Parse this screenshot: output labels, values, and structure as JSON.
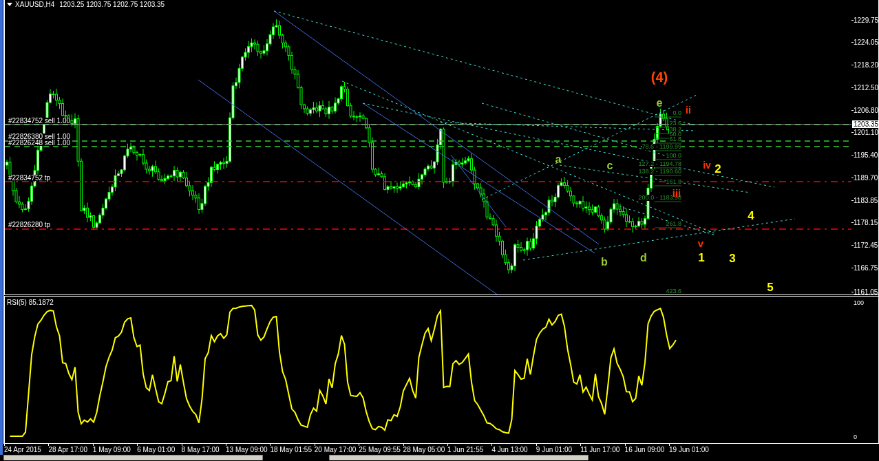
{
  "header": {
    "symbol": "XAUUSD,H4",
    "ohlc": "1203.25 1203.75 1202.75 1203.35"
  },
  "price_axis": {
    "ticks": [
      "1229.75",
      "1224.05",
      "1218.20",
      "1212.50",
      "1206.80",
      "1201.10",
      "1195.40",
      "1189.70",
      "1183.85",
      "1178.15",
      "1172.45",
      "1166.75",
      "1161.05"
    ],
    "current_price": "1203.35"
  },
  "orders": [
    {
      "label": "#22834752 sell 1.00",
      "kind": "sell"
    },
    {
      "label": "#22826380 sell 1.00",
      "kind": "sell"
    },
    {
      "label": "#22826248 sell 1.00",
      "kind": "sell"
    },
    {
      "label": "#22834752 tp",
      "kind": "tp"
    },
    {
      "label": "#22826280 tp",
      "kind": "tp"
    }
  ],
  "wave_labels": [
    {
      "text": "(4)",
      "color": "#ff4500"
    },
    {
      "text": "e",
      "color": "#9acd32"
    },
    {
      "text": "a",
      "color": "#9acd32"
    },
    {
      "text": "c",
      "color": "#9acd32"
    },
    {
      "text": "b",
      "color": "#9acd32"
    },
    {
      "text": "d",
      "color": "#9acd32"
    },
    {
      "text": "ii",
      "color": "#ff3300"
    },
    {
      "text": "iv",
      "color": "#ff3300"
    },
    {
      "text": "iii",
      "color": "#ff3300"
    },
    {
      "text": "v",
      "color": "#ff3300"
    },
    {
      "text": "2",
      "color": "#ffff00"
    },
    {
      "text": "4",
      "color": "#ffff00"
    },
    {
      "text": "1",
      "color": "#ffff00"
    },
    {
      "text": "3",
      "color": "#ffff00"
    },
    {
      "text": "5",
      "color": "#ffff00"
    }
  ],
  "fib_levels": [
    "0.0",
    "23.6",
    "38.2",
    "50.0",
    "61.8",
    "78.6 - 1199.99",
    "100.0",
    "127.2 - 1194.78",
    "138.2 - 1190.60",
    "161.8",
    "200.0 - 1183.98",
    "261.8",
    "423.6"
  ],
  "rsi": {
    "label": "RSI(5) 85.1872",
    "ticks": [
      "100",
      "0"
    ]
  },
  "time_axis": [
    "24 Apr 2015",
    "28 Apr 17:00",
    "1 May 09:00",
    "6 May 01:00",
    "8 May 17:00",
    "13 May 09:00",
    "18 May 01:55",
    "20 May 17:00",
    "25 May 09:55",
    "28 May 05:00",
    "1 Jun 21:55",
    "4 Jun 13:00",
    "9 Jun 01:00",
    "11 Jun 17:00",
    "16 Jun 09:00",
    "19 Jun 01:00"
  ]
}
